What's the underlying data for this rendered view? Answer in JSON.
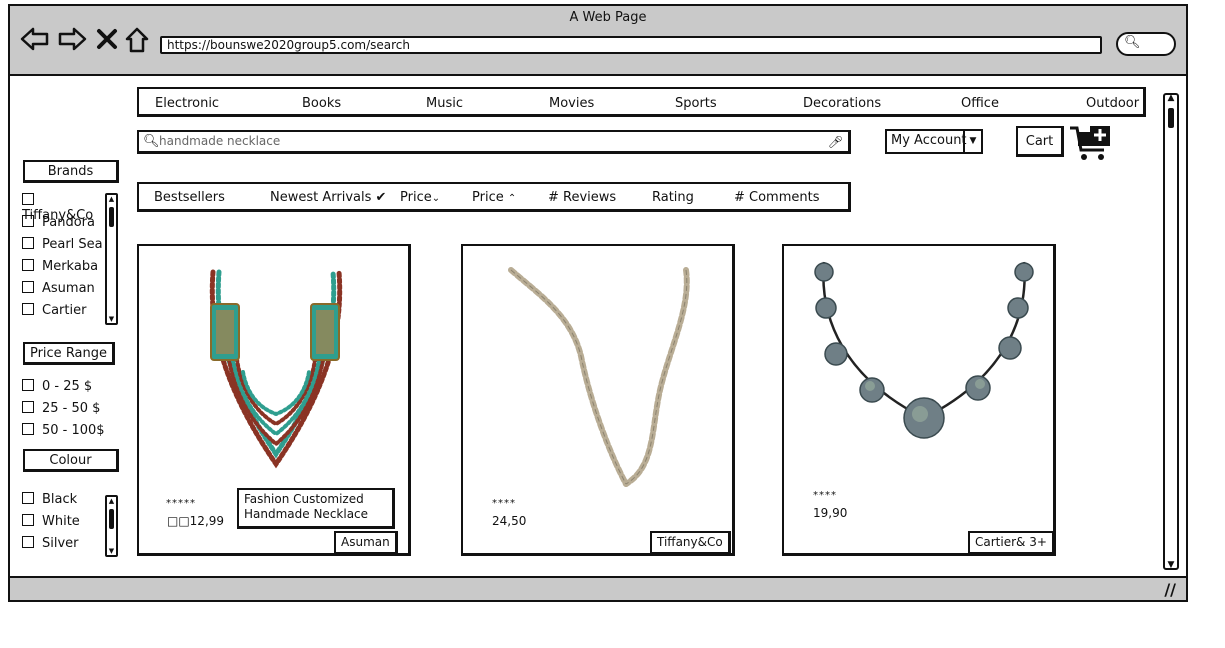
{
  "window": {
    "title": "A Web Page",
    "url": "https://bounswe2020group5.com/search",
    "nav_icons": [
      "back-icon",
      "forward-icon",
      "close-icon",
      "home-icon"
    ]
  },
  "categories": [
    "Electronic",
    "Books",
    "Music",
    "Movies",
    "Sports",
    "Decorations",
    "Office",
    "Outdoor"
  ],
  "search": {
    "placeholder": "handmade necklace"
  },
  "account": {
    "label": "My Account"
  },
  "cart": {
    "label": "Cart"
  },
  "sort": {
    "options": [
      "Bestsellers",
      "Newest Arrivals",
      "Price",
      "Price",
      "# Reviews",
      "Rating",
      "# Comments"
    ]
  },
  "filters": {
    "brands": {
      "title": "Brands",
      "items": [
        "Tiffany&Co",
        "Pandora",
        "Pearl Sea",
        "Merkaba",
        "Asuman",
        "Cartier"
      ]
    },
    "price": {
      "title": "Price Range",
      "items": [
        "0 - 25 $",
        "25 - 50 $",
        "50 - 100$"
      ]
    },
    "colour": {
      "title": "Colour",
      "items": [
        "Black",
        "White",
        "Silver"
      ]
    }
  },
  "products": [
    {
      "stars": "*****",
      "price": "□□12,99",
      "name": "Fashion Customized Handmade Necklace",
      "brand": "Asuman"
    },
    {
      "stars": "****",
      "price": "24,50",
      "brand": "Tiffany&Co"
    },
    {
      "stars": "****",
      "price": "19,90",
      "brand": "Cartier& 3+"
    }
  ],
  "colors": {
    "chrome": "#c9c9c9",
    "turquoise": "#2f9e8f",
    "coral": "#8a3324",
    "abalone": "#6f7f86"
  }
}
